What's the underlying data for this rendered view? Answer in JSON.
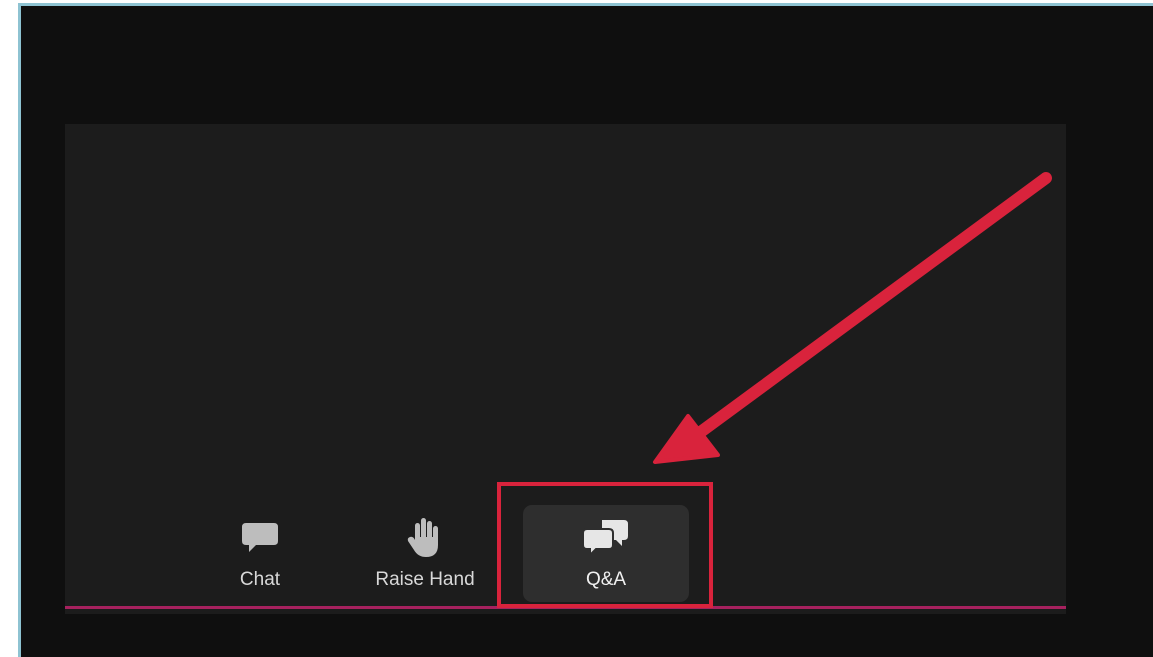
{
  "toolbar": {
    "buttons": [
      {
        "id": "chat",
        "label": "Chat",
        "icon": "chat-bubble-icon"
      },
      {
        "id": "raise_hand",
        "label": "Raise Hand",
        "icon": "raised-hand-icon"
      },
      {
        "id": "qa",
        "label": "Q&A",
        "icon": "qa-bubbles-icon",
        "selected": true
      }
    ],
    "accent_color": "#a6215e"
  },
  "annotation": {
    "type": "callout-arrow-and-box",
    "target": "Q&A",
    "color": "#d9233c"
  }
}
